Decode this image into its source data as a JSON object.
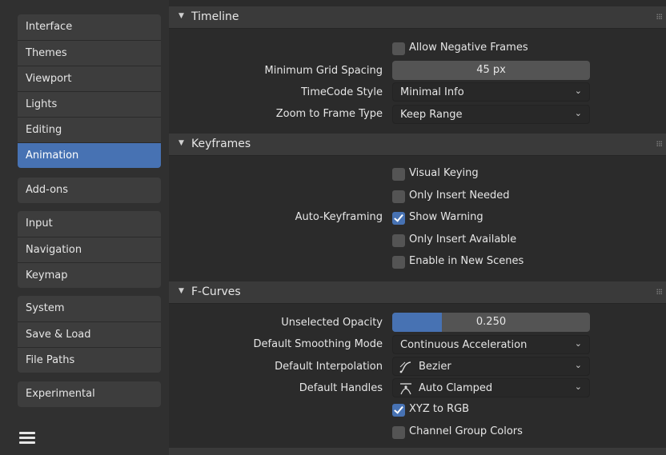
{
  "sidebar": {
    "groups": [
      [
        "Interface",
        "Themes",
        "Viewport",
        "Lights",
        "Editing",
        "Animation"
      ],
      [
        "Add-ons"
      ],
      [
        "Input",
        "Navigation",
        "Keymap"
      ],
      [
        "System",
        "Save & Load",
        "File Paths"
      ],
      [
        "Experimental"
      ]
    ],
    "active": "Animation"
  },
  "timeline": {
    "title": "Timeline",
    "allow_negative_frames": "Allow Negative Frames",
    "min_grid_label": "Minimum Grid Spacing",
    "min_grid_value": "45 px",
    "timecode_label": "TimeCode Style",
    "timecode_value": "Minimal Info",
    "zoom_label": "Zoom to Frame Type",
    "zoom_value": "Keep Range"
  },
  "keyframes": {
    "title": "Keyframes",
    "visual_keying": "Visual Keying",
    "only_insert_needed": "Only Insert Needed",
    "auto_label": "Auto-Keyframing",
    "show_warning": "Show Warning",
    "only_insert_available": "Only Insert Available",
    "enable_new_scenes": "Enable in New Scenes"
  },
  "fcurves": {
    "title": "F-Curves",
    "opacity_label": "Unselected Opacity",
    "opacity_value": "0.250",
    "opacity_fraction": 0.25,
    "smoothing_label": "Default Smoothing Mode",
    "smoothing_value": "Continuous Acceleration",
    "interp_label": "Default Interpolation",
    "interp_value": "Bezier",
    "handles_label": "Default Handles",
    "handles_value": "Auto Clamped",
    "xyz_rgb": "XYZ to RGB",
    "channel_group_colors": "Channel Group Colors"
  },
  "colors": {
    "accent": "#4772b3",
    "panel": "#2b2b2b",
    "header": "#3a3a3a"
  }
}
